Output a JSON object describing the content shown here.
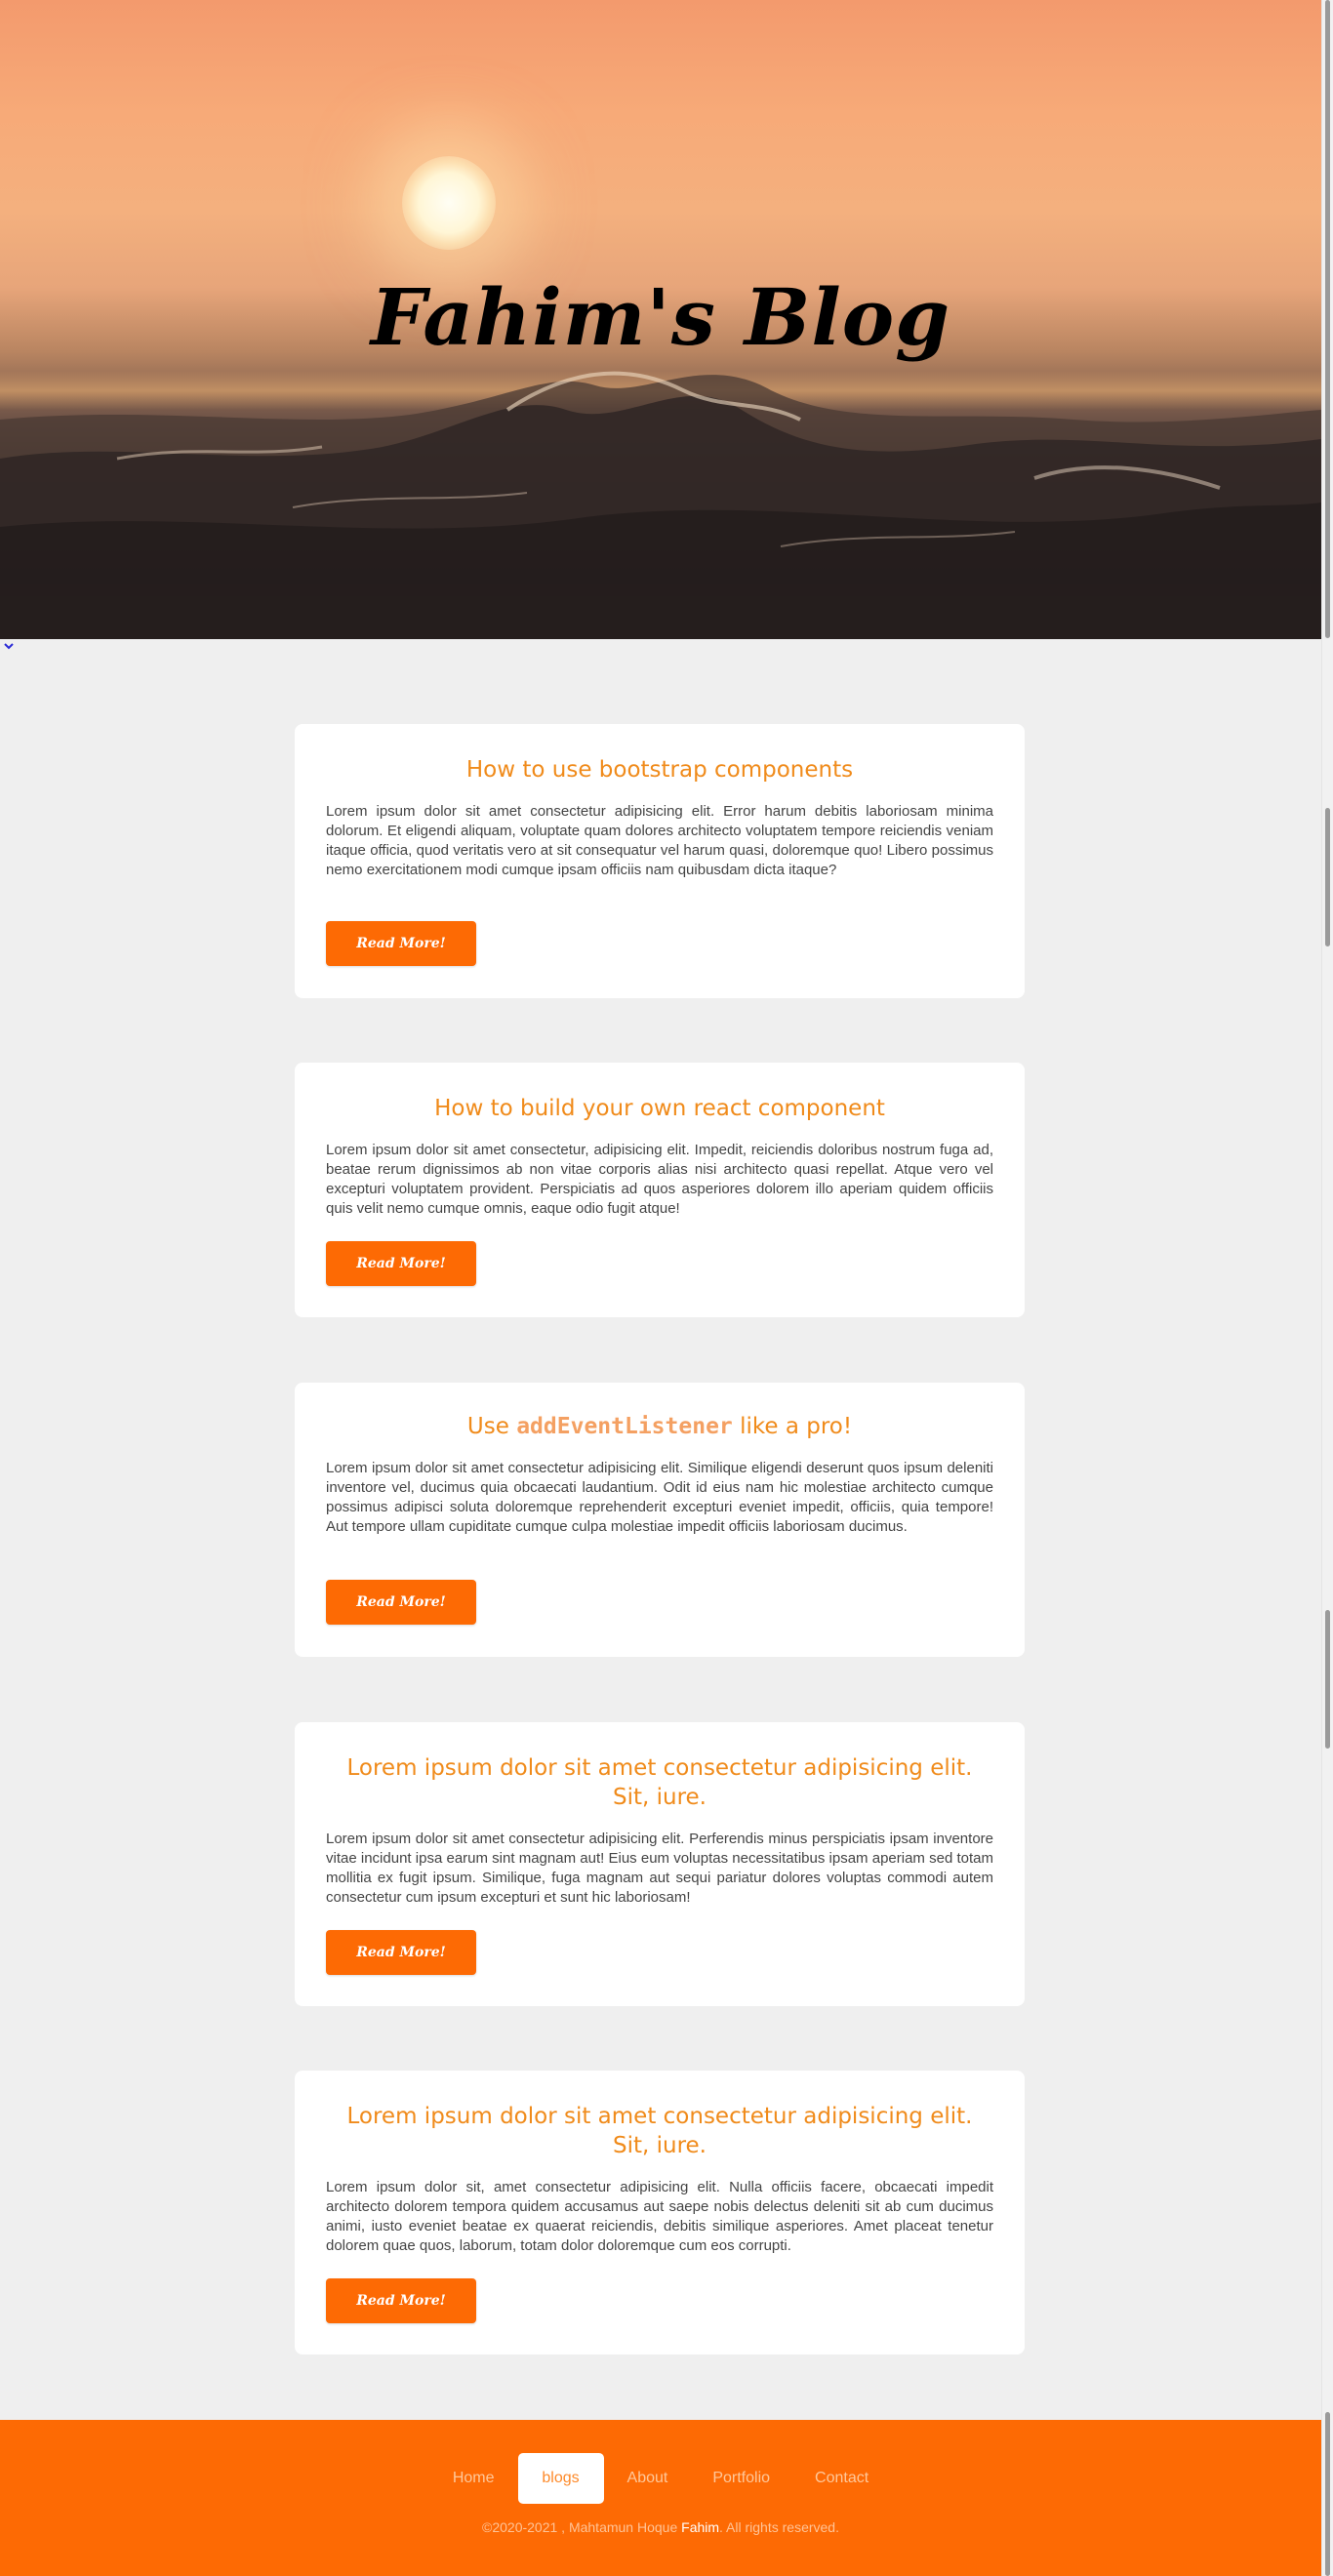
{
  "hero": {
    "title": "Fahim's Blog"
  },
  "posts": [
    {
      "title": "How to use bootstrap components",
      "text": "Lorem ipsum dolor sit amet consectetur adipisicing elit. Error harum debitis laboriosam minima dolorum. Et eligendi aliquam, voluptate quam dolores architecto voluptatem tempore reiciendis veniam itaque officia, quod veritatis vero at sit consequatur vel harum quasi, doloremque quo! Libero possimus nemo exercitationem modi cumque ipsam officiis nam quibusdam dicta itaque?",
      "button": "Read More!"
    },
    {
      "title": "How to build your own react component",
      "text": "Lorem ipsum dolor sit amet consectetur, adipisicing elit. Impedit, reiciendis doloribus nostrum fuga ad, beatae rerum dignissimos ab non vitae corporis alias nisi architecto quasi repellat. Atque vero vel excepturi voluptatem provident. Perspiciatis ad quos asperiores dolorem illo aperiam quidem officiis quis velit nemo cumque omnis, eaque odio fugit atque!",
      "button": "Read More!"
    },
    {
      "title_prefix": "Use ",
      "title_code": "addEventListener",
      "title_suffix": " like a pro!",
      "text": "Lorem ipsum dolor sit amet consectetur adipisicing elit. Similique eligendi deserunt quos ipsum deleniti inventore vel, ducimus quia obcaecati laudantium. Odit id eius nam hic molestiae architecto cumque possimus adipisci soluta doloremque reprehenderit excepturi eveniet impedit, officiis, quia tempore! Aut tempore ullam cupiditate cumque culpa molestiae impedit officiis laboriosam ducimus.",
      "button": "Read More!"
    },
    {
      "title": "Lorem ipsum dolor sit amet consectetur adipisicing elit. Sit, iure.",
      "text": "Lorem ipsum dolor sit amet consectetur adipisicing elit. Perferendis minus perspiciatis ipsam inventore vitae incidunt ipsa earum sint magnam aut! Eius eum voluptas necessitatibus ipsam aperiam sed totam mollitia ex fugit ipsum. Similique, fuga magnam aut sequi pariatur dolores voluptas commodi autem consectetur cum ipsum excepturi et sunt hic laboriosam!",
      "button": "Read More!"
    },
    {
      "title": "Lorem ipsum dolor sit amet consectetur adipisicing elit. Sit, iure.",
      "text": "Lorem ipsum dolor sit, amet consectetur adipisicing elit. Nulla officiis facere, obcaecati impedit architecto dolorem tempora quidem accusamus aut saepe nobis delectus deleniti sit ab cum ducimus animi, iusto eveniet beatae ex quaerat reiciendis, debitis similique asperiores. Amet placeat tenetur dolorem quae quos, laborum, totam dolor doloremque cum eos corrupti.",
      "button": "Read More!"
    }
  ],
  "footer": {
    "nav": [
      "Home",
      "blogs",
      "About",
      "Portfolio",
      "Contact"
    ],
    "active_nav": "blogs",
    "copyright_prefix": "©2020-2021 , Mahtamun Hoque ",
    "copyright_name": "Fahim",
    "copyright_suffix": ". All rights reserved."
  },
  "colors": {
    "accent": "#fd6a04",
    "title": "#f08b1b",
    "page_bg": "#efefef"
  },
  "icons": {
    "scroll_down": "chevron-down-icon"
  }
}
